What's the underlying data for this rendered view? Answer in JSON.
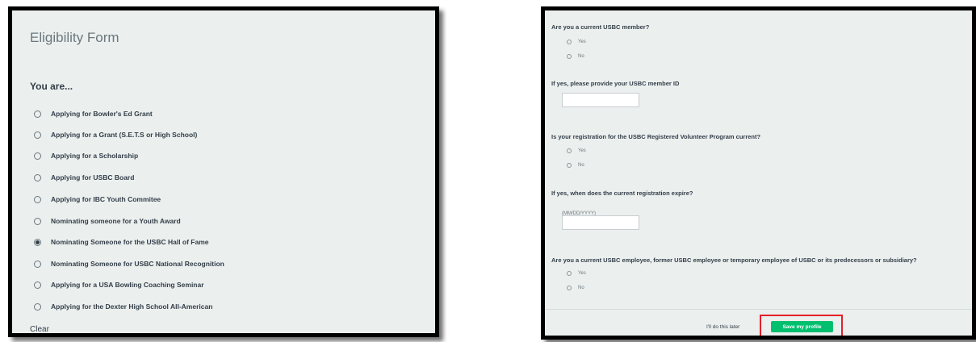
{
  "left_panel": {
    "title": "Eligibility Form",
    "question": "You are...",
    "options": [
      {
        "label": "Applying for Bowler's Ed Grant",
        "checked": false
      },
      {
        "label": "Applying for a Grant (S.E.T.S or High School)",
        "checked": false
      },
      {
        "label": "Applying for a Scholarship",
        "checked": false
      },
      {
        "label": "Applying for USBC Board",
        "checked": false
      },
      {
        "label": "Applying for IBC Youth Commitee",
        "checked": false
      },
      {
        "label": "Nominating someone for a Youth Award",
        "checked": false
      },
      {
        "label": "Nominating Someone for the USBC Hall of Fame",
        "checked": true
      },
      {
        "label": "Nominating Someone for USBC National Recognition",
        "checked": false
      },
      {
        "label": "Applying for a USA Bowling Coaching Seminar",
        "checked": false
      },
      {
        "label": "Applying for the Dexter High School All-American",
        "checked": false
      }
    ],
    "clear_label": "Clear"
  },
  "right_panel": {
    "q1": {
      "text": "Are you a current USBC member?",
      "yes": "Yes",
      "no": "No"
    },
    "q2": {
      "text": "If yes, please provide your USBC member ID",
      "value": ""
    },
    "q3": {
      "text": "Is your registration for the USBC Registered Volunteer Program current?",
      "yes": "Yes",
      "no": "No"
    },
    "q4": {
      "text": "If yes, when does the current registration expire?",
      "hint": "(MM/DD/YYYY)",
      "value": ""
    },
    "q5": {
      "text": "Are you a current USBC employee, former USBC employee or temporary employee of USBC or its predecessors or subsidiary?",
      "yes": "Yes",
      "no": "No"
    },
    "footer": {
      "later_label": "I'll do this later",
      "save_label": "Save my profile"
    }
  },
  "colors": {
    "accent_green": "#00bf6f",
    "highlight_red": "#e2202a",
    "panel_bg": "#ebefee",
    "text_dark": "#333e48"
  }
}
